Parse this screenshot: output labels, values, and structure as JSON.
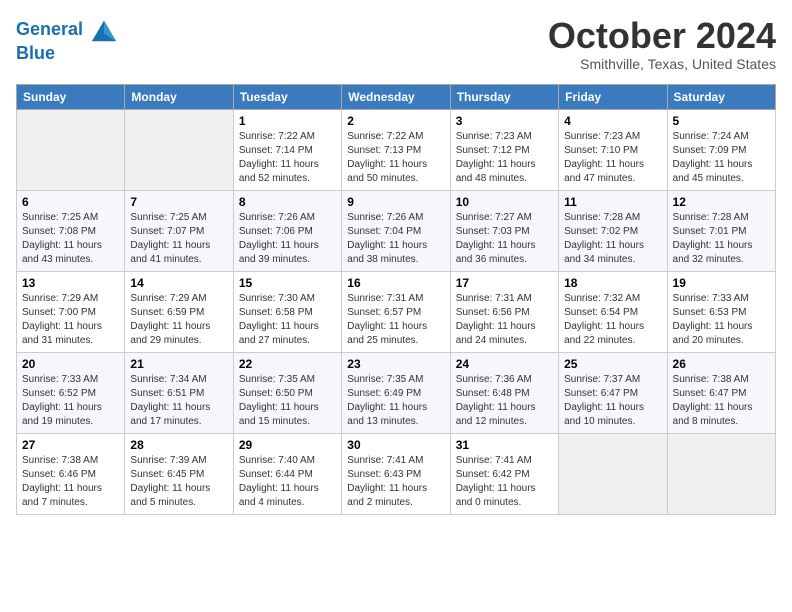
{
  "header": {
    "logo_line1": "General",
    "logo_line2": "Blue",
    "month_title": "October 2024",
    "location": "Smithville, Texas, United States"
  },
  "weekdays": [
    "Sunday",
    "Monday",
    "Tuesday",
    "Wednesday",
    "Thursday",
    "Friday",
    "Saturday"
  ],
  "weeks": [
    [
      {
        "num": "",
        "detail": ""
      },
      {
        "num": "",
        "detail": ""
      },
      {
        "num": "1",
        "detail": "Sunrise: 7:22 AM\nSunset: 7:14 PM\nDaylight: 11 hours and 52 minutes."
      },
      {
        "num": "2",
        "detail": "Sunrise: 7:22 AM\nSunset: 7:13 PM\nDaylight: 11 hours and 50 minutes."
      },
      {
        "num": "3",
        "detail": "Sunrise: 7:23 AM\nSunset: 7:12 PM\nDaylight: 11 hours and 48 minutes."
      },
      {
        "num": "4",
        "detail": "Sunrise: 7:23 AM\nSunset: 7:10 PM\nDaylight: 11 hours and 47 minutes."
      },
      {
        "num": "5",
        "detail": "Sunrise: 7:24 AM\nSunset: 7:09 PM\nDaylight: 11 hours and 45 minutes."
      }
    ],
    [
      {
        "num": "6",
        "detail": "Sunrise: 7:25 AM\nSunset: 7:08 PM\nDaylight: 11 hours and 43 minutes."
      },
      {
        "num": "7",
        "detail": "Sunrise: 7:25 AM\nSunset: 7:07 PM\nDaylight: 11 hours and 41 minutes."
      },
      {
        "num": "8",
        "detail": "Sunrise: 7:26 AM\nSunset: 7:06 PM\nDaylight: 11 hours and 39 minutes."
      },
      {
        "num": "9",
        "detail": "Sunrise: 7:26 AM\nSunset: 7:04 PM\nDaylight: 11 hours and 38 minutes."
      },
      {
        "num": "10",
        "detail": "Sunrise: 7:27 AM\nSunset: 7:03 PM\nDaylight: 11 hours and 36 minutes."
      },
      {
        "num": "11",
        "detail": "Sunrise: 7:28 AM\nSunset: 7:02 PM\nDaylight: 11 hours and 34 minutes."
      },
      {
        "num": "12",
        "detail": "Sunrise: 7:28 AM\nSunset: 7:01 PM\nDaylight: 11 hours and 32 minutes."
      }
    ],
    [
      {
        "num": "13",
        "detail": "Sunrise: 7:29 AM\nSunset: 7:00 PM\nDaylight: 11 hours and 31 minutes."
      },
      {
        "num": "14",
        "detail": "Sunrise: 7:29 AM\nSunset: 6:59 PM\nDaylight: 11 hours and 29 minutes."
      },
      {
        "num": "15",
        "detail": "Sunrise: 7:30 AM\nSunset: 6:58 PM\nDaylight: 11 hours and 27 minutes."
      },
      {
        "num": "16",
        "detail": "Sunrise: 7:31 AM\nSunset: 6:57 PM\nDaylight: 11 hours and 25 minutes."
      },
      {
        "num": "17",
        "detail": "Sunrise: 7:31 AM\nSunset: 6:56 PM\nDaylight: 11 hours and 24 minutes."
      },
      {
        "num": "18",
        "detail": "Sunrise: 7:32 AM\nSunset: 6:54 PM\nDaylight: 11 hours and 22 minutes."
      },
      {
        "num": "19",
        "detail": "Sunrise: 7:33 AM\nSunset: 6:53 PM\nDaylight: 11 hours and 20 minutes."
      }
    ],
    [
      {
        "num": "20",
        "detail": "Sunrise: 7:33 AM\nSunset: 6:52 PM\nDaylight: 11 hours and 19 minutes."
      },
      {
        "num": "21",
        "detail": "Sunrise: 7:34 AM\nSunset: 6:51 PM\nDaylight: 11 hours and 17 minutes."
      },
      {
        "num": "22",
        "detail": "Sunrise: 7:35 AM\nSunset: 6:50 PM\nDaylight: 11 hours and 15 minutes."
      },
      {
        "num": "23",
        "detail": "Sunrise: 7:35 AM\nSunset: 6:49 PM\nDaylight: 11 hours and 13 minutes."
      },
      {
        "num": "24",
        "detail": "Sunrise: 7:36 AM\nSunset: 6:48 PM\nDaylight: 11 hours and 12 minutes."
      },
      {
        "num": "25",
        "detail": "Sunrise: 7:37 AM\nSunset: 6:47 PM\nDaylight: 11 hours and 10 minutes."
      },
      {
        "num": "26",
        "detail": "Sunrise: 7:38 AM\nSunset: 6:47 PM\nDaylight: 11 hours and 8 minutes."
      }
    ],
    [
      {
        "num": "27",
        "detail": "Sunrise: 7:38 AM\nSunset: 6:46 PM\nDaylight: 11 hours and 7 minutes."
      },
      {
        "num": "28",
        "detail": "Sunrise: 7:39 AM\nSunset: 6:45 PM\nDaylight: 11 hours and 5 minutes."
      },
      {
        "num": "29",
        "detail": "Sunrise: 7:40 AM\nSunset: 6:44 PM\nDaylight: 11 hours and 4 minutes."
      },
      {
        "num": "30",
        "detail": "Sunrise: 7:41 AM\nSunset: 6:43 PM\nDaylight: 11 hours and 2 minutes."
      },
      {
        "num": "31",
        "detail": "Sunrise: 7:41 AM\nSunset: 6:42 PM\nDaylight: 11 hours and 0 minutes."
      },
      {
        "num": "",
        "detail": ""
      },
      {
        "num": "",
        "detail": ""
      }
    ]
  ]
}
